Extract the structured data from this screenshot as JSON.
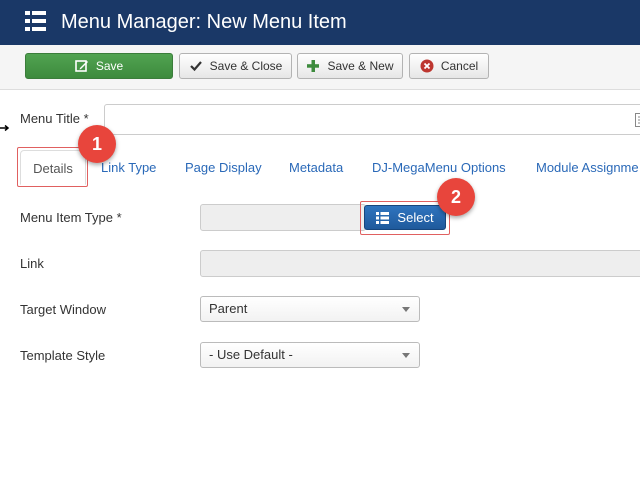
{
  "header": {
    "title": "Menu Manager: New Menu Item",
    "icon": "list-icon",
    "bg_color": "#1a3867"
  },
  "toolbar": {
    "save_label": "Save",
    "save_close_label": "Save & Close",
    "save_new_label": "Save & New",
    "cancel_label": "Cancel"
  },
  "menu_title": {
    "label": "Menu Title *",
    "value": ""
  },
  "tabs": [
    {
      "label": "Details",
      "active": true
    },
    {
      "label": "Link Type"
    },
    {
      "label": "Page Display"
    },
    {
      "label": "Metadata"
    },
    {
      "label": "DJ-MegaMenu Options"
    },
    {
      "label": "Module Assignme"
    }
  ],
  "form": {
    "menu_item_type_label": "Menu Item Type *",
    "menu_item_type_value": "",
    "select_button_label": "Select",
    "link_label": "Link",
    "link_value": "",
    "target_window_label": "Target Window",
    "target_window_value": "Parent",
    "template_style_label": "Template Style",
    "template_style_value": "- Use Default -"
  },
  "annotations": {
    "step1": "1",
    "step2": "2",
    "badge_color": "#e8453c"
  }
}
